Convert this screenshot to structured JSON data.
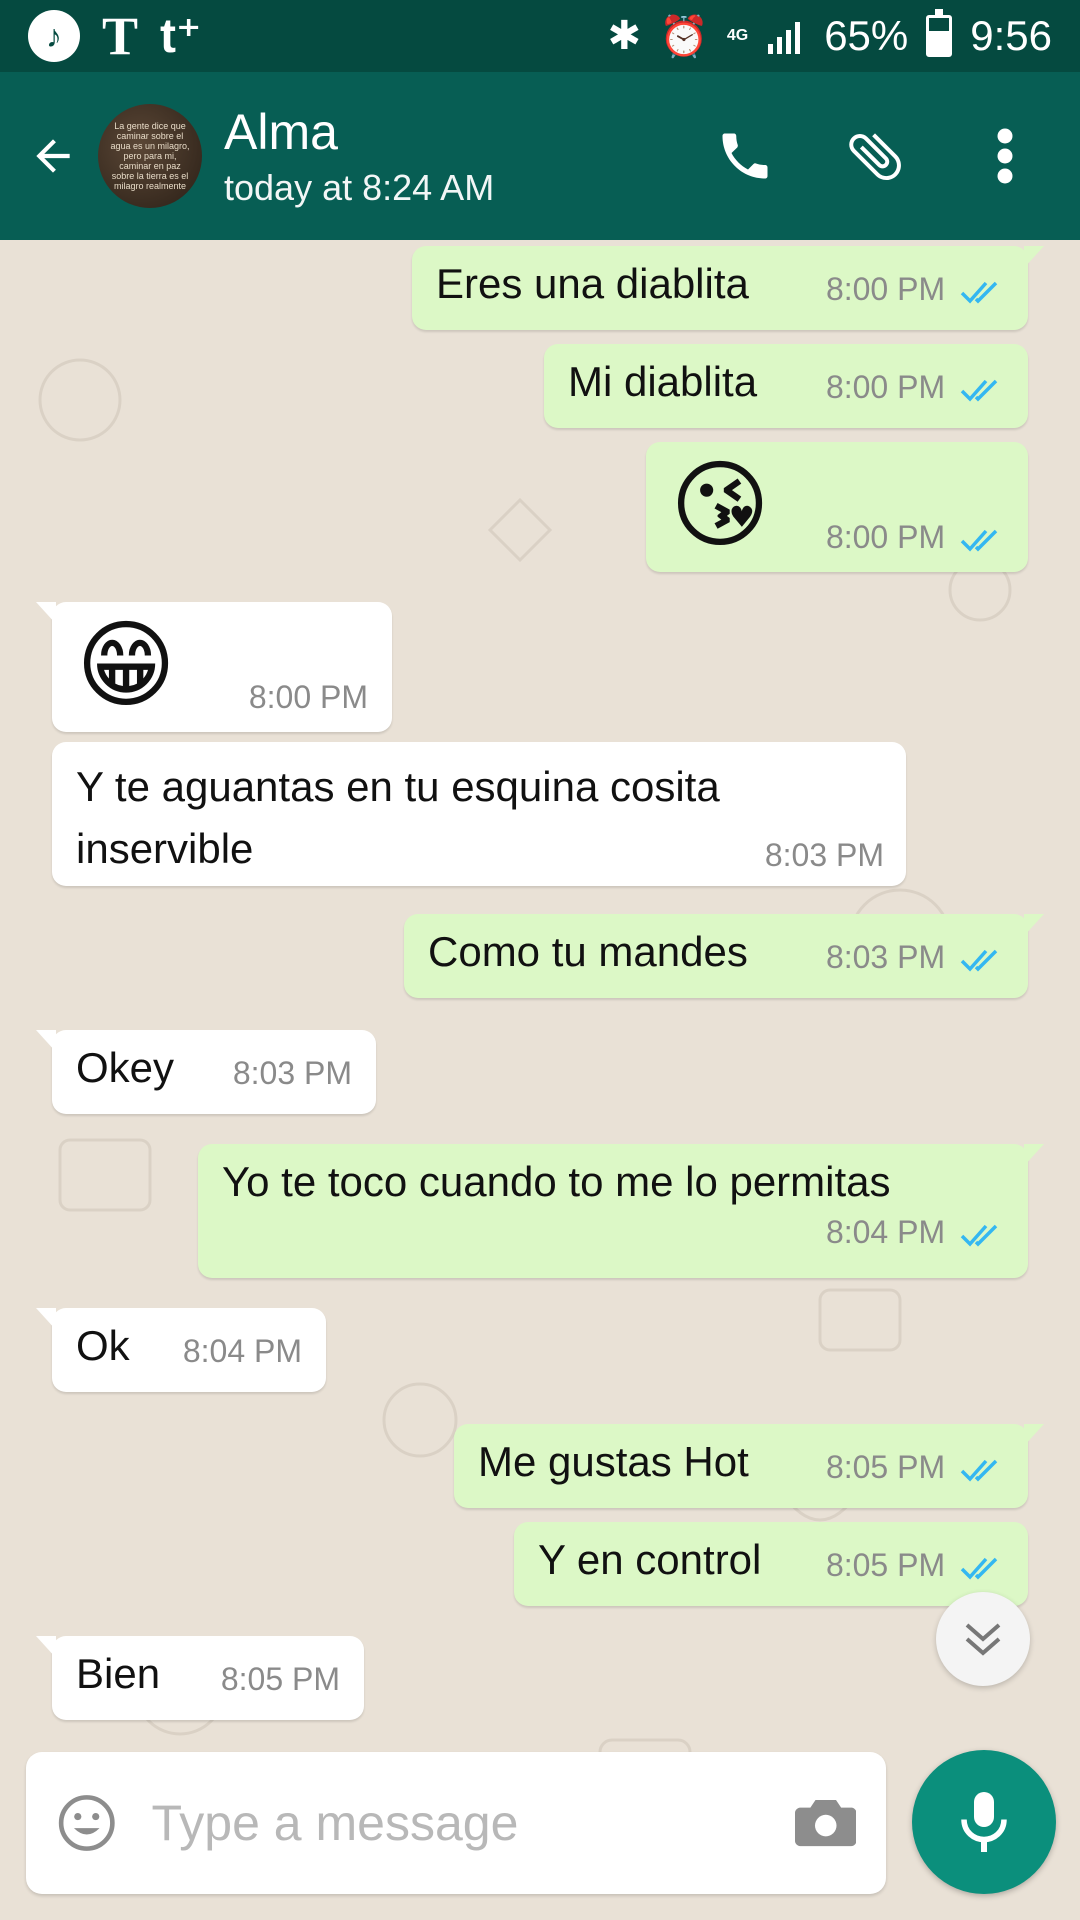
{
  "statusbar": {
    "network": "4G",
    "battery": "65%",
    "battery_level": 0.65,
    "time": "9:56"
  },
  "header": {
    "contact_name": "Alma",
    "last_seen": "today at 8:24 AM",
    "avatar_text": "La gente dice que caminar sobre el agua es un milagro, pero para mi, caminar en paz sobre la tierra es el milagro realmente"
  },
  "messages": [
    {
      "dir": "out",
      "text": "Eres una diablita",
      "time": "8:00 PM"
    },
    {
      "dir": "out",
      "text": "Mi diablita",
      "time": "8:00 PM"
    },
    {
      "dir": "out",
      "text": "😘",
      "time": "8:00 PM"
    },
    {
      "dir": "in",
      "text": "😁",
      "time": "8:00 PM"
    },
    {
      "dir": "in",
      "text": "Y te aguantas en tu esquina cosita inservible",
      "time": "8:03 PM"
    },
    {
      "dir": "out",
      "text": "Como tu mandes",
      "time": "8:03 PM"
    },
    {
      "dir": "in",
      "text": "Okey",
      "time": "8:03 PM"
    },
    {
      "dir": "out",
      "text": "Yo te toco cuando to me lo permitas",
      "time": "8:04 PM"
    },
    {
      "dir": "in",
      "text": "Ok",
      "time": "8:04 PM"
    },
    {
      "dir": "out",
      "text": "Me gustas Hot",
      "time": "8:05 PM"
    },
    {
      "dir": "out",
      "text": "Y en control",
      "time": "8:05 PM"
    },
    {
      "dir": "in",
      "text": "Bien",
      "time": "8:05 PM"
    }
  ],
  "composer": {
    "placeholder": "Type a message"
  },
  "colors": {
    "header": "#075e54",
    "statusbar": "#054a40",
    "outgoing_bubble": "#dcf8c6",
    "incoming_bubble": "#ffffff",
    "read_tick": "#34b7f1",
    "mic_button": "#0b8f7c"
  }
}
